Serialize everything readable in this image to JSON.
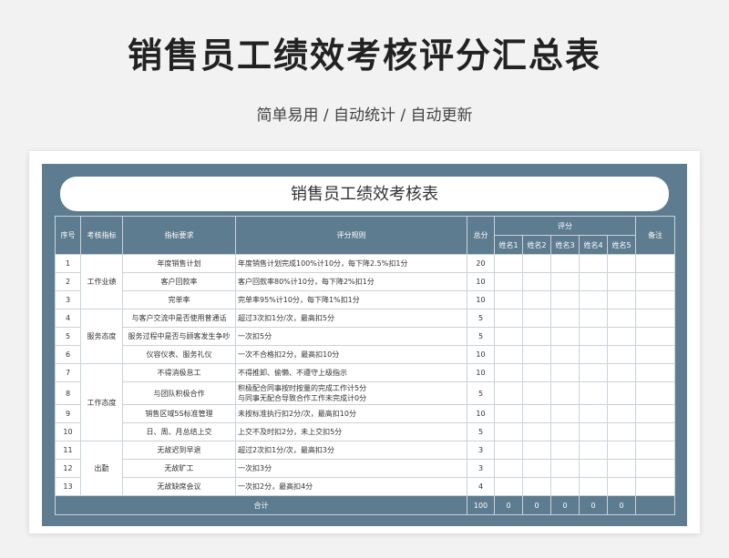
{
  "header": {
    "title": "销售员工绩效考核评分汇总表",
    "subtitle": "简单易用 / 自动统计 / 自动更新"
  },
  "sheet": {
    "title": "销售员工绩效考核表",
    "columns": {
      "index": "序号",
      "category": "考核指标",
      "requirement": "指标要求",
      "rule": "评分规则",
      "total": "总分",
      "score": "评分",
      "remark": "备注"
    },
    "raters": [
      "姓名1",
      "姓名2",
      "姓名3",
      "姓名4",
      "姓名5"
    ],
    "categories": {
      "work": "工作业绩",
      "service": "服务态度",
      "attitude": "工作态度",
      "attendance": "出勤"
    },
    "rows": [
      {
        "no": "1",
        "req": "年度销售计划",
        "rule": "年度销售计划完成100%计10分，每下降2.5%扣1分",
        "total": "20"
      },
      {
        "no": "2",
        "req": "客户回款率",
        "rule": "客户回款率80%计10分，每下降2%扣1分",
        "total": "10"
      },
      {
        "no": "3",
        "req": "完单率",
        "rule": "完单率95%计10分，每下降1%扣1分",
        "total": "10"
      },
      {
        "no": "4",
        "req": "与客户交流中是否使用普通话",
        "rule": "超过3次扣1分/次，最高扣5分",
        "total": "5"
      },
      {
        "no": "5",
        "req": "服务过程中是否与顾客发生争吵",
        "rule": "一次扣5分",
        "total": "5"
      },
      {
        "no": "6",
        "req": "仪容仪表、服务礼仪",
        "rule": "一次不合格扣2分，最高扣10分",
        "total": "10"
      },
      {
        "no": "7",
        "req": "不得消极怠工",
        "rule": "不得推卸、偷懒、不遵守上级指示",
        "total": "10"
      },
      {
        "no": "8",
        "req": "与团队积极合作",
        "rule": "积极配合同事按时按量的完成工作计5分",
        "rule2": "与同事无配合导致合作工作未完成计0分",
        "total": "5"
      },
      {
        "no": "9",
        "req": "销售区域5S标准管理",
        "rule": "未按标准执行扣2分/次，最高扣10分",
        "total": "10"
      },
      {
        "no": "10",
        "req": "日、周、月总结上交",
        "rule": "上交不及时扣2分，未上交扣5分",
        "total": "5"
      },
      {
        "no": "11",
        "req": "无故迟到早退",
        "rule": "超过2次扣1分/次，最高扣3分",
        "total": "3"
      },
      {
        "no": "12",
        "req": "无故旷工",
        "rule": "一次扣3分",
        "total": "3"
      },
      {
        "no": "13",
        "req": "无故缺席会议",
        "rule": "一次扣2分，最高扣4分",
        "total": "4"
      }
    ],
    "footer": {
      "label": "合计",
      "total": "100",
      "scores": [
        "0",
        "0",
        "0",
        "0",
        "0"
      ]
    }
  },
  "colors": {
    "frame": "#5e7c90",
    "page_bg": "#f2f2f2",
    "grid": "#c9d3da"
  }
}
